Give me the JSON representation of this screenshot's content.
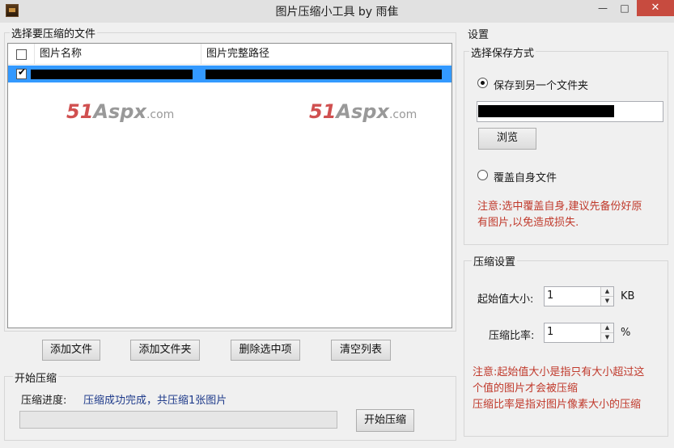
{
  "window": {
    "title": "图片压缩小工具 by 雨隹",
    "min_glyph": "—",
    "max_glyph": "□",
    "close_glyph": "✕"
  },
  "file_group": {
    "title": "选择要压缩的文件",
    "columns": [
      "图片名称",
      "图片完整路径"
    ],
    "rows": [
      {
        "checked": true
      }
    ]
  },
  "watermark": {
    "num": "51",
    "brand": "Aspx",
    "suffix": ".com"
  },
  "file_buttons": {
    "add_file": "添加文件",
    "add_folder": "添加文件夹",
    "delete_selected": "删除选中项",
    "clear_list": "清空列表"
  },
  "compress_group": {
    "title": "开始压缩",
    "progress_label": "压缩进度:",
    "status": "压缩成功完成，共压缩1张图片",
    "progress_fraction": 0,
    "start_button": "开始压缩"
  },
  "settings": {
    "title": "设置",
    "save_mode_title": "选择保存方式",
    "option_other_folder": "保存到另一个文件夹",
    "option_overwrite": "覆盖自身文件",
    "browse_button": "浏览",
    "overwrite_note_line1": "注意:选中覆盖自身,建议先备份好原",
    "overwrite_note_line2": "有图片,以免造成损失.",
    "compress_settings_title": "压缩设置",
    "start_size_label": "起始值大小:",
    "start_size_value": "1",
    "start_size_unit": "KB",
    "ratio_label": "压缩比率:",
    "ratio_value": "1",
    "ratio_unit": "%",
    "note_line1": "注意:起始值大小是指只有大小超过这",
    "note_line2": "个值的图片才会被压缩",
    "note_line3": "压缩比率是指对图片像素大小的压缩"
  },
  "colors": {
    "note_red": "#c0392b",
    "status_blue": "#1e3a8a",
    "selection": "#3399ff"
  }
}
